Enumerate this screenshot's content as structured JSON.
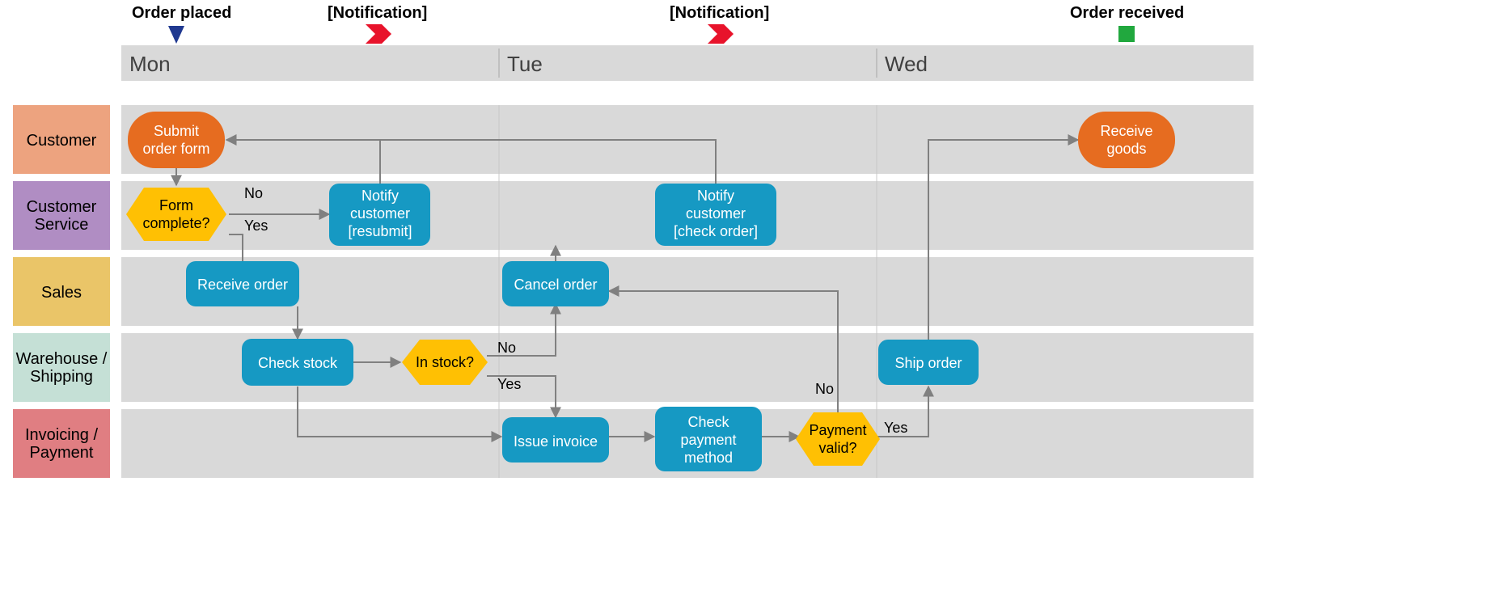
{
  "milestones": {
    "start": {
      "label": "Order placed"
    },
    "notif1": {
      "label": "[Notification]"
    },
    "notif2": {
      "label": "[Notification]"
    },
    "end": {
      "label": "Order received"
    }
  },
  "days": {
    "mon": "Mon",
    "tue": "Tue",
    "wed": "Wed"
  },
  "lanes": {
    "customer": "Customer",
    "service_l1": "Customer",
    "service_l2": "Service",
    "sales": "Sales",
    "warehouse_l1": "Warehouse /",
    "warehouse_l2": "Shipping",
    "invoicing_l1": "Invoicing /",
    "invoicing_l2": "Payment"
  },
  "nodes": {
    "submit_l1": "Submit",
    "submit_l2": "order form",
    "formq_l1": "Form",
    "formq_l2": "complete?",
    "notify_resubmit_l1": "Notify",
    "notify_resubmit_l2": "customer",
    "notify_resubmit_l3": "[resubmit]",
    "receive_order": "Receive order",
    "check_stock": "Check stock",
    "in_stock": "In stock?",
    "cancel_order": "Cancel order",
    "notify_check_l1": "Notify",
    "notify_check_l2": "customer",
    "notify_check_l3": "[check order]",
    "issue_invoice": "Issue invoice",
    "check_payment_l1": "Check",
    "check_payment_l2": "payment",
    "check_payment_l3": "method",
    "payment_valid_l1": "Payment",
    "payment_valid_l2": "valid?",
    "ship_order": "Ship order",
    "receive_goods_l1": "Receive",
    "receive_goods_l2": "goods"
  },
  "labels": {
    "no": "No",
    "yes": "Yes"
  }
}
